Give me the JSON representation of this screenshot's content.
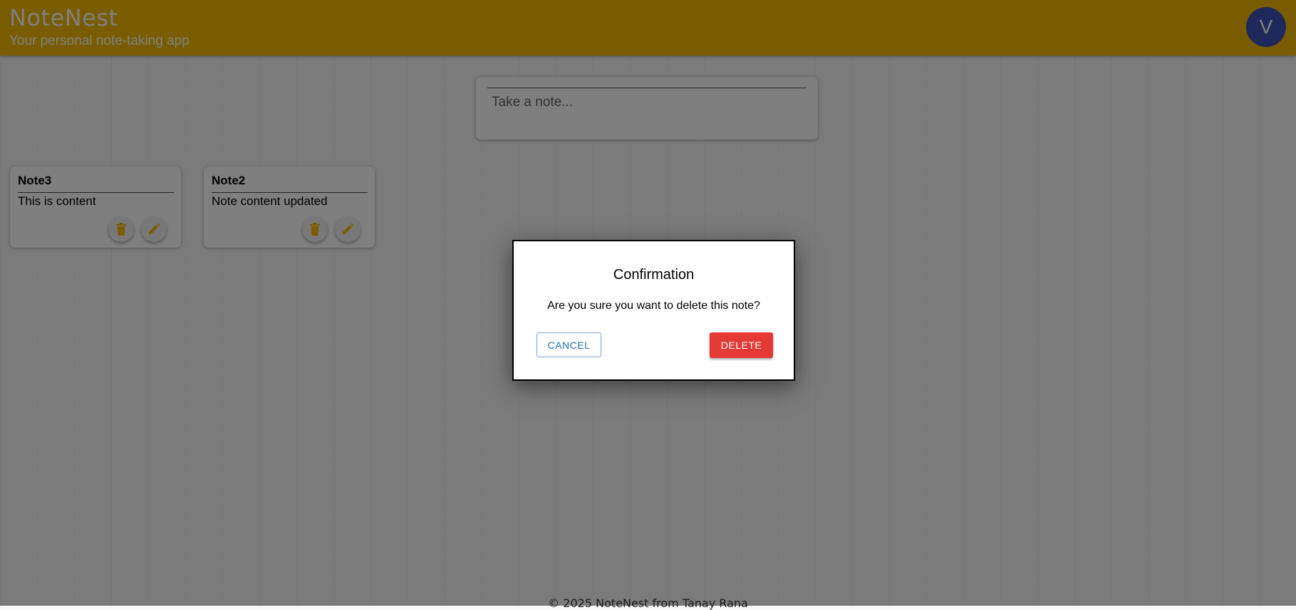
{
  "app": {
    "title": "NoteNest",
    "subtitle": "Your personal note-taking app",
    "avatar_initial": "V",
    "accent_color": "#f5b800"
  },
  "composer": {
    "placeholder": "Take a note..."
  },
  "notes": [
    {
      "title": "Note3",
      "content": "This is content",
      "delete_icon": "trash-icon",
      "edit_icon": "pencil-icon"
    },
    {
      "title": "Note2",
      "content": "Note content updated",
      "delete_icon": "trash-icon",
      "edit_icon": "pencil-icon"
    }
  ],
  "footer": {
    "text": "© 2025 NoteNest from Tanay Rana"
  },
  "dialog": {
    "title": "Confirmation",
    "message": "Are you sure you want to delete this note?",
    "cancel_label": "CANCEL",
    "delete_label": "DELETE",
    "delete_color": "#e53935"
  }
}
